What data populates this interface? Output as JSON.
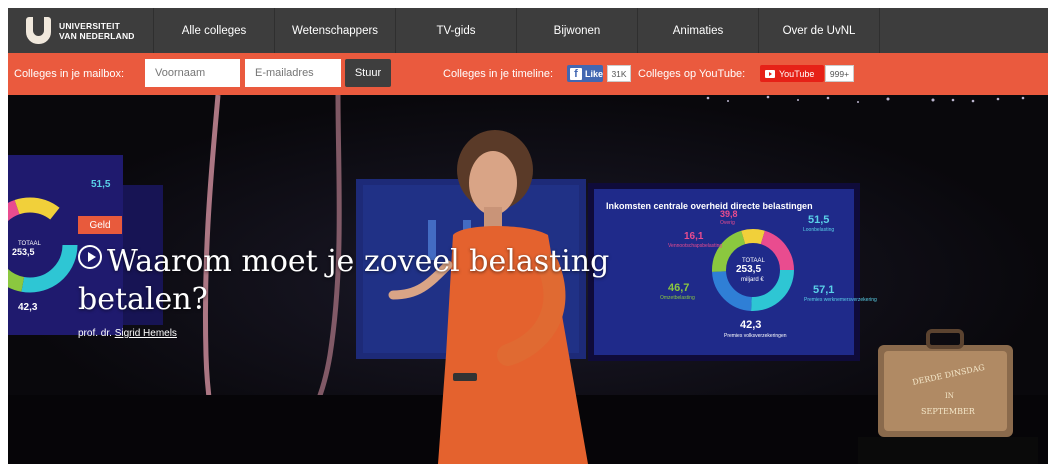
{
  "brand": {
    "line1": "UNIVERSITEIT",
    "line2": "VAN NEDERLAND"
  },
  "nav": {
    "items": [
      "Alle colleges",
      "Wetenschappers",
      "TV-gids",
      "Bijwonen",
      "Animaties",
      "Over de UvNL"
    ]
  },
  "bar": {
    "mailbox_label": "Colleges in je mailbox:",
    "firstname_placeholder": "Voornaam",
    "email_placeholder": "E-mailadres",
    "submit_label": "Stuur",
    "timeline_label": "Colleges in je timeline:",
    "fb_label": "Like",
    "fb_count": "31K",
    "youtube_label_prefix": "Colleges op YouTube:",
    "youtube_label": "YouTube",
    "youtube_count": "999+"
  },
  "hero": {
    "category": "Geld",
    "title": "Waarom moet je zoveel belasting betalen?",
    "author_prefix": "prof. dr.",
    "author_name": "Sigrid Hemels",
    "screen": {
      "heading": "Inkomsten centrale overheid directe belastingen",
      "total_label": "TOTAAL",
      "total_value": "253,5",
      "total_unit": "miljard €",
      "values": [
        "51,5",
        "57,1",
        "42,3",
        "46,7",
        "16,1",
        "39,8"
      ],
      "labels": [
        "Loonbelasting",
        "Premies werknemers­verzekering",
        "Premies volksverzekeringen",
        "Omzetbelasting",
        "Vennootschaps­belasting",
        "Overig"
      ]
    },
    "left_screen": {
      "values": [
        "51,5",
        "253,5",
        "42,3"
      ],
      "total_label": "TOTAAL"
    },
    "suitcase": {
      "line1": "DERDE DINSDAG",
      "line2": "IN",
      "line3": "SEPTEMBER"
    }
  },
  "colors": {
    "nav_bg": "#3d3d3d",
    "accent": "#ea5a3e",
    "fb": "#4267b2",
    "youtube": "#e62117"
  }
}
